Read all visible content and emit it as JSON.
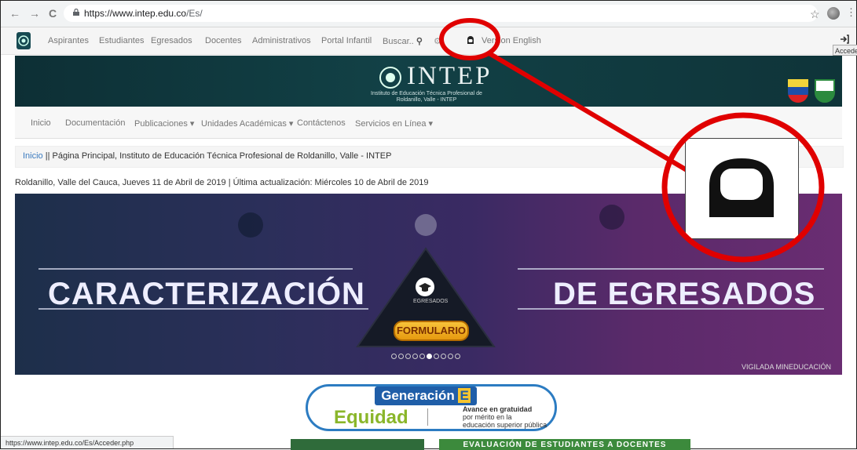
{
  "browser": {
    "url_host": "https://www.intep.edu.co",
    "url_path": "/Es/",
    "status_url": "https://www.intep.edu.co/Es/Acceder.php"
  },
  "topnav": {
    "items": [
      "Aspirantes",
      "Estudiantes",
      "Egresados",
      "Docentes",
      "Administrativos",
      "Portal Infantil"
    ],
    "search_label": "Buscar..",
    "language_label": "Version English",
    "login_tooltip": "Acceder"
  },
  "banner": {
    "title": "INTEP",
    "subtitle": "Instituto de Educación Técnica Profesional de Roldanillo, Valle - INTEP"
  },
  "mainnav": {
    "items": [
      "Inicio",
      "Documentación",
      "Publicaciones",
      "Unidades Académicas",
      "Contáctenos",
      "Servicios en Línea"
    ]
  },
  "breadcrumb": {
    "home": "Inicio",
    "sep": " || ",
    "current": "Página Principal, Instituto de Educación Técnica Profesional de Roldanillo, Valle - INTEP"
  },
  "dateline": "Roldanillo, Valle del Cauca, Jueves 11 de Abril de 2019 | Última actualización: Miércoles 10 de Abril de 2019",
  "hero": {
    "left_text": "CARACTERIZACIÓN",
    "right_text": "DE EGRESADOS",
    "badge_label": "EGRESADOS",
    "button_label": "FORMULARIO",
    "footer_text": "VIGILADA MINEDUCACIÓN",
    "slide_count": 10,
    "active_slide": 6
  },
  "promo": {
    "title": "Generación",
    "title_letter": "E",
    "subtitle": "Equidad",
    "desc_line1": "Avance en gratuidad",
    "desc_line2": "por mérito en la",
    "desc_line3": "educación superior pública"
  },
  "bottom_banner": "EVALUACIÓN DE ESTUDIANTES A DOCENTES",
  "colors": {
    "highlight": "#e00000",
    "banner_bg": "#0f3439",
    "link": "#3b7bbf"
  }
}
